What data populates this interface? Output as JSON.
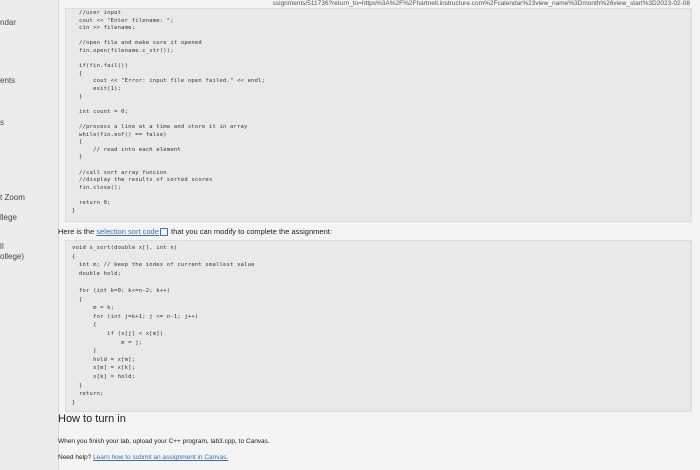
{
  "url": "ssignments/511736?return_to=https%3A%2F%2Fhartnell.instructure.com%2Fcalendar%23view_name%3Dmonth%26view_start%3D2023-02-08",
  "sidebar": {
    "items": [
      "ndar",
      "ents",
      "s",
      "t Zoom",
      "llege",
      "lI",
      "ollege)"
    ]
  },
  "code1": [
    "  //user input",
    "  cout << \"Enter filename: \";",
    "  cin >> filename;",
    "",
    "  //open file and make sure it opened",
    "  fin.open(filename.c_str());",
    "",
    "  if(fin.fail())",
    "  {",
    "      cout << \"Error: input file open failed.\" << endl;",
    "      exit(1);",
    "  }",
    "",
    "  int count = 0;",
    "",
    "  //process a line at a time and store it in array",
    "  while(fin.eof() == false)",
    "  {",
    "      // read into each element",
    "  }",
    "",
    "  //call sort array funcion",
    "  //display the results of sorted scores",
    "  fin.close();",
    "",
    "  return 0;",
    "}"
  ],
  "intro": {
    "before": "Here is the ",
    "link": "selection sort code",
    "after": " that you can modify to complete the assignment:"
  },
  "code2": [
    "void s_sort(double x[], int n)",
    "{",
    "  int m; // keep the index of current smallest value",
    "  double hold;",
    "",
    "  for (int k=0; k<=n-2; k++)",
    "  {",
    "      m = k;",
    "      for (int j=k+1; j <= n-1; j++)",
    "      {",
    "          if (x[j] < x[m])",
    "              m = j;",
    "      }",
    "      hold = x[m];",
    "      x[m] = x[k];",
    "      x[k] = hold;",
    "  }",
    "  return;",
    "}"
  ],
  "turn_in": {
    "heading": "How to turn in",
    "line1": "When you finish your lab, upload your C++ program, lab3.cpp, to Canvas.",
    "help_label": "Need help? ",
    "help_link": "Learn how to submit an assignment in Canvas."
  }
}
